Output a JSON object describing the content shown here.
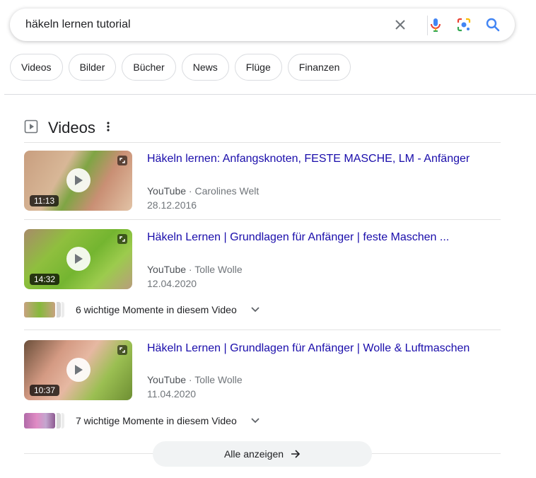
{
  "search": {
    "query": "häkeln lernen tutorial",
    "icons": [
      "clear-icon",
      "microphone-icon",
      "lens-icon",
      "search-icon"
    ]
  },
  "chips": [
    "Videos",
    "Bilder",
    "Bücher",
    "News",
    "Flüge",
    "Finanzen"
  ],
  "section": {
    "title": "Videos",
    "icon": "video-play-icon"
  },
  "videos": [
    {
      "title": "Häkeln lernen: Anfangsknoten, FESTE MASCHE, LM - Anfänger",
      "source": "YouTube",
      "channel": "Carolines Welt",
      "date": "28.12.2016",
      "duration": "11:13"
    },
    {
      "title": "Häkeln Lernen | Grundlagen für Anfänger | feste Maschen ...",
      "source": "YouTube",
      "channel": "Tolle Wolle",
      "date": "12.04.2020",
      "duration": "14:32",
      "moments": "6 wichtige Momente in diesem Video"
    },
    {
      "title": "Häkeln Lernen | Grundlagen für Anfänger | Wolle & Luftmaschen",
      "source": "YouTube",
      "channel": "Tolle Wolle",
      "date": "11.04.2020",
      "duration": "10:37",
      "moments": "7 wichtige Momente in diesem Video"
    }
  ],
  "meta_separator": "·",
  "show_all": "Alle anzeigen",
  "colors": {
    "link": "#1a0dab",
    "brand_blue": "#4285f4",
    "brand_red": "#ea4335",
    "brand_yellow": "#fbbc05",
    "brand_green": "#34a853"
  }
}
